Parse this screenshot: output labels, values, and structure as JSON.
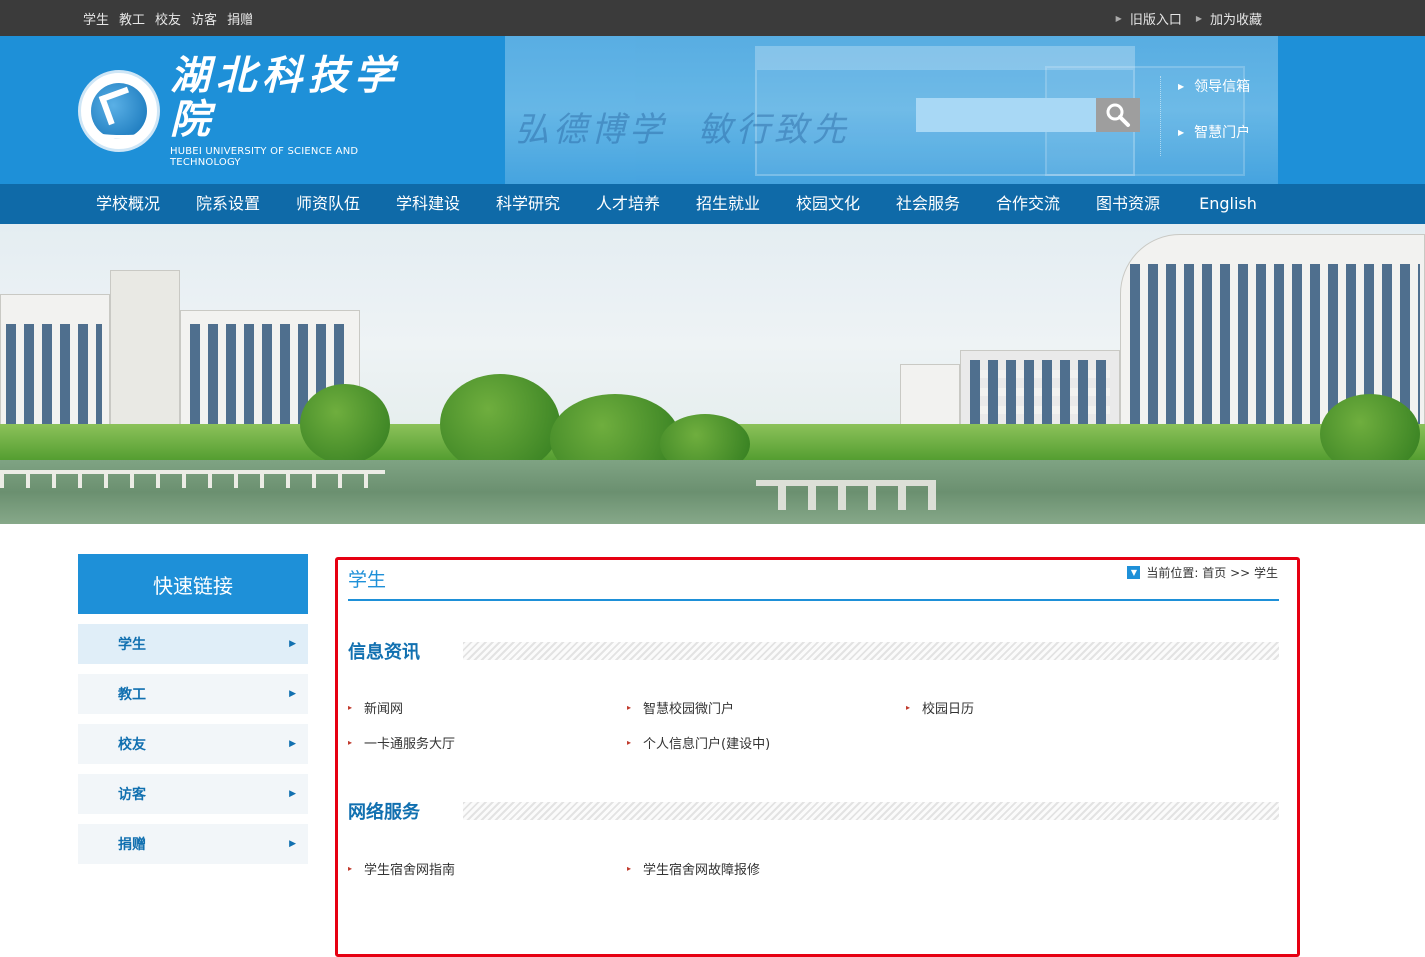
{
  "topbar": {
    "left_links": [
      "学生",
      "教工",
      "校友",
      "访客",
      "捐赠"
    ],
    "right_links": [
      "旧版入口",
      "加为收藏"
    ]
  },
  "header": {
    "logo_cn": "湖北科技学院",
    "logo_en": "HUBEI UNIVERSITY OF SCIENCE AND TECHNOLOGY",
    "motto_1": "弘德博学",
    "motto_2": "敏行致先",
    "search_placeholder": "",
    "side_links": [
      "领导信箱",
      "智慧门户"
    ]
  },
  "nav": {
    "items": [
      "学校概况",
      "院系设置",
      "师资队伍",
      "学科建设",
      "科学研究",
      "人才培养",
      "招生就业",
      "校园文化",
      "社会服务",
      "合作交流",
      "图书资源",
      "English"
    ]
  },
  "sidebar": {
    "title": "快速链接",
    "items": [
      {
        "label": "学生",
        "active": true
      },
      {
        "label": "教工",
        "active": false
      },
      {
        "label": "校友",
        "active": false
      },
      {
        "label": "访客",
        "active": false
      },
      {
        "label": "捐赠",
        "active": false
      }
    ]
  },
  "main": {
    "title": "学生",
    "breadcrumb": "当前位置: 首页 >> 学生",
    "sections": [
      {
        "title": "信息资讯",
        "links": [
          "新闻网",
          "智慧校园微门户",
          "校园日历",
          "一卡通服务大厅",
          "个人信息门户(建设中)"
        ]
      },
      {
        "title": "网络服务",
        "links": [
          "学生宿舍网指南",
          "学生宿舍网故障报修"
        ]
      }
    ]
  },
  "colors": {
    "header_blue": "#1e90d8",
    "nav_blue": "#0f6aa8",
    "topbar": "#3b3b3b",
    "highlight_border": "#e60012"
  }
}
